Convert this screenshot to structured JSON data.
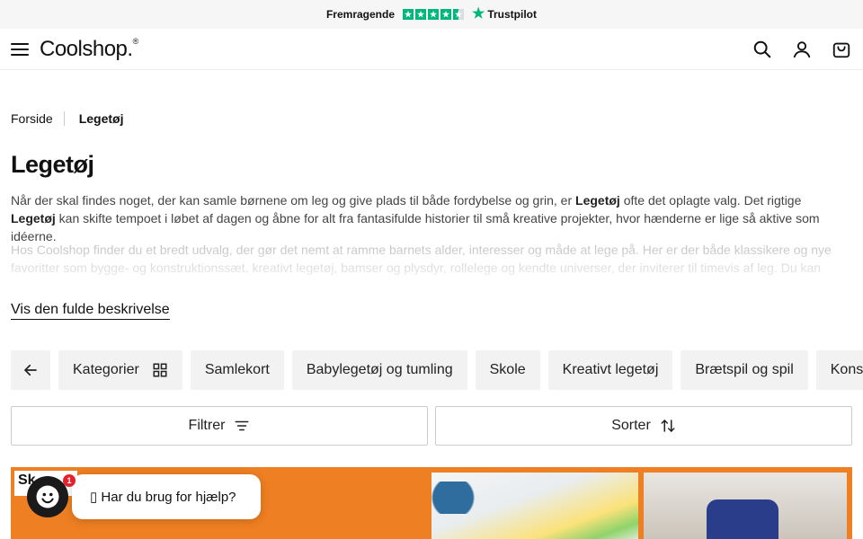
{
  "trustbar": {
    "rating_text": "Fremragende",
    "brand": "Trustpilot",
    "stars": 4.5,
    "star_color": "#00b67a"
  },
  "header": {
    "logo": "Coolshop.",
    "logo_mark": "®",
    "icons": [
      "menu-icon",
      "search-icon",
      "user-icon",
      "bag-icon"
    ]
  },
  "breadcrumb": {
    "home": "Forside",
    "current": "Legetøj"
  },
  "page": {
    "title": "Legetøj",
    "desc1_a": "Når der skal findes noget, der kan samle børnene om leg og give plads til både fordybelse og grin, er ",
    "desc1_b": "Legetøj",
    "desc1_c": " ofte det oplagte valg. Det rigtige ",
    "desc1_d": "Legetøj",
    "desc1_e": " kan skifte tempoet i løbet af dagen og åbne for alt fra fantasifulde historier til små kreative projekter, hvor hænderne er lige så aktive som idéerne.",
    "desc2": "Hos Coolshop finder du et bredt udvalg, der gør det nemt at ramme barnets alder, interesser og måde at lege på. Her er der både klassikere og nye favoritter som bygge- og konstruktionssæt, kreativt legetøj, bamser og plysdyr, rollelege og kendte universer, der inviterer til timevis af leg. Du kan også",
    "more_link": "Vis den fulde beskrivelse"
  },
  "chips": [
    "Kategorier",
    "Samlekort",
    "Babylegetøj og tumling",
    "Skole",
    "Kreativt legetøj",
    "Brætspil og spil",
    "Kons"
  ],
  "controls": {
    "filter": "Filtrer",
    "sort": "Sorter"
  },
  "banner": {
    "color": "#ee7f22",
    "tag_text": "Sk"
  },
  "chat": {
    "badge": "1",
    "prompt": "▯ Har du brug for hjælp?"
  }
}
